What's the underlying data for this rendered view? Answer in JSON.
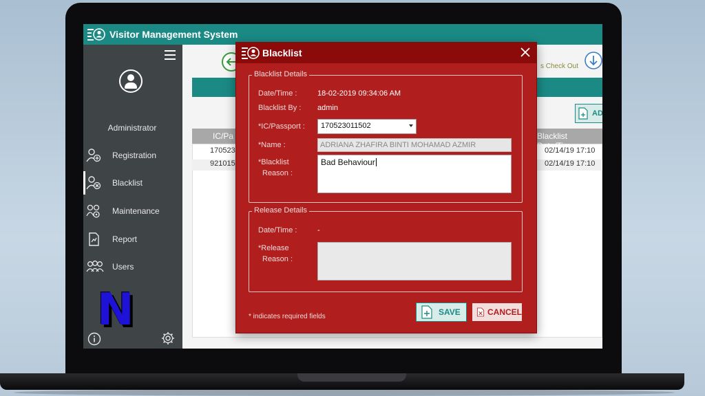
{
  "app": {
    "title": "Visitor Management System"
  },
  "sidebar": {
    "user_label": "Administrator",
    "items": [
      {
        "label": "Registration",
        "icon": "user-add-icon"
      },
      {
        "label": "Blacklist",
        "icon": "user-block-icon"
      },
      {
        "label": "Maintenance",
        "icon": "users-gear-icon"
      },
      {
        "label": "Report",
        "icon": "report-icon"
      },
      {
        "label": "Users",
        "icon": "users-icon"
      }
    ],
    "logo_letter": "N"
  },
  "main": {
    "checkout_label": "s Check Out",
    "add_button_label": "AD",
    "table": {
      "columns": [
        "IC/Pa",
        "Blacklist Date/Tim"
      ],
      "rows": [
        {
          "ic": "170523",
          "date": "02/14/19 17:10"
        },
        {
          "ic": "921015",
          "date": "02/14/19 17:10"
        }
      ]
    }
  },
  "modal": {
    "title": "Blacklist",
    "blacklist_details": {
      "legend": "Blacklist Details",
      "datetime_label": "Date/Time :",
      "datetime_value": "18-02-2019 09:34:06 AM",
      "by_label": "Blacklist By :",
      "by_value": "admin",
      "ic_label": "*IC/Passport :",
      "ic_value": "170523011502",
      "name_label": "*Name :",
      "name_value": "ADRIANA ZHAFIRA BINTI MOHAMAD AZMIR",
      "reason_label_1": "*Blacklist",
      "reason_label_2": "Reason :",
      "reason_value": "Bad Behaviour"
    },
    "release_details": {
      "legend": "Release Details",
      "datetime_label": "Date/Time :",
      "datetime_value": "-",
      "reason_label_1": "*Release",
      "reason_label_2": "Reason :",
      "reason_value": ""
    },
    "required_note": "* indicates required fields",
    "save_label": "SAVE",
    "cancel_label": "CANCEL"
  },
  "colors": {
    "teal": "#1b8a85",
    "sidebar": "#3f4447",
    "modal_red": "#b01e1e",
    "modal_header": "#8b0b0b"
  }
}
